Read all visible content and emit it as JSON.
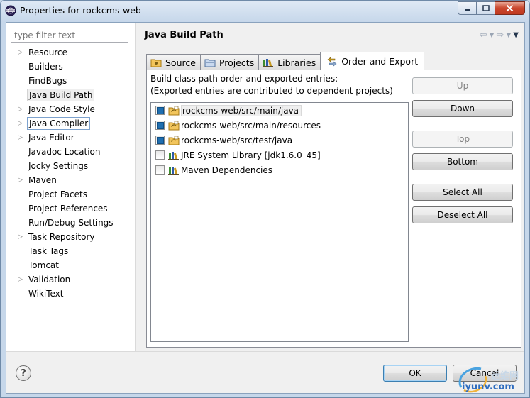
{
  "window": {
    "title": "Properties for rockcms-web"
  },
  "sidebar": {
    "filter_placeholder": "type filter text",
    "items": [
      {
        "label": "Resource",
        "expandable": true
      },
      {
        "label": "Builders",
        "expandable": false
      },
      {
        "label": "FindBugs",
        "expandable": false
      },
      {
        "label": "Java Build Path",
        "expandable": false,
        "selected": true
      },
      {
        "label": "Java Code Style",
        "expandable": true
      },
      {
        "label": "Java Compiler",
        "expandable": true,
        "focused": true
      },
      {
        "label": "Java Editor",
        "expandable": true
      },
      {
        "label": "Javadoc Location",
        "expandable": false
      },
      {
        "label": "Jocky Settings",
        "expandable": false
      },
      {
        "label": "Maven",
        "expandable": true
      },
      {
        "label": "Project Facets",
        "expandable": false
      },
      {
        "label": "Project References",
        "expandable": false
      },
      {
        "label": "Run/Debug Settings",
        "expandable": false
      },
      {
        "label": "Task Repository",
        "expandable": true
      },
      {
        "label": "Task Tags",
        "expandable": false
      },
      {
        "label": "Tomcat",
        "expandable": false
      },
      {
        "label": "Validation",
        "expandable": true
      },
      {
        "label": "WikiText",
        "expandable": false
      }
    ]
  },
  "page": {
    "title": "Java Build Path",
    "tabs": [
      {
        "label": "Source",
        "icon": "source-folder-icon"
      },
      {
        "label": "Projects",
        "icon": "projects-icon"
      },
      {
        "label": "Libraries",
        "icon": "libraries-icon"
      },
      {
        "label": "Order and Export",
        "icon": "order-export-icon",
        "active": true
      }
    ],
    "description_line1": "Build class path order and exported entries:",
    "description_line2": "(Exported entries are contributed to dependent projects)",
    "entries": [
      {
        "label": "rockcms-web/src/main/java",
        "checked": true,
        "icon": "source-folder-icon"
      },
      {
        "label": "rockcms-web/src/main/resources",
        "checked": true,
        "icon": "source-folder-icon"
      },
      {
        "label": "rockcms-web/src/test/java",
        "checked": true,
        "icon": "source-folder-icon"
      },
      {
        "label": "JRE System Library [jdk1.6.0_45]",
        "checked": false,
        "icon": "library-icon"
      },
      {
        "label": "Maven Dependencies",
        "checked": false,
        "icon": "library-icon"
      }
    ],
    "buttons": {
      "up": "Up",
      "down": "Down",
      "top": "Top",
      "bottom": "Bottom",
      "select_all": "Select All",
      "deselect_all": "Deselect All"
    }
  },
  "footer": {
    "ok": "OK",
    "cancel": "Cancel",
    "help_symbol": "?"
  },
  "watermark": {
    "line1": "运维网",
    "line2": "iyunv.com"
  }
}
